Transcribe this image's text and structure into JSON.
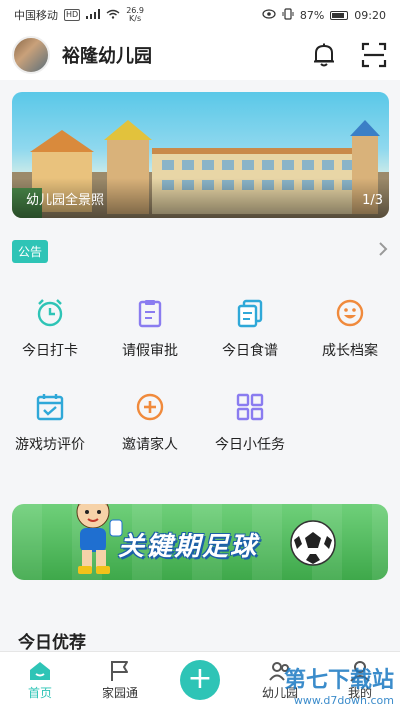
{
  "status_bar": {
    "carrier": "中国移动",
    "network_badge": "HD",
    "net_speed_value": "26.9",
    "net_speed_unit": "K/s",
    "battery": "87%",
    "time": "09:20"
  },
  "header": {
    "title": "裕隆幼儿园",
    "icons": [
      "bell-icon",
      "scan-icon"
    ]
  },
  "banner": {
    "caption": "幼儿园全景照",
    "counter": "1/3"
  },
  "notice": {
    "badge": "公告"
  },
  "features": [
    {
      "label": "今日打卡",
      "icon": "alarm-clock-icon",
      "color": "#2ec4b6"
    },
    {
      "label": "请假审批",
      "icon": "clipboard-icon",
      "color": "#8a7cf0"
    },
    {
      "label": "今日食谱",
      "icon": "documents-icon",
      "color": "#2fa8d8"
    },
    {
      "label": "成长档案",
      "icon": "smile-icon",
      "color": "#f08a3c"
    },
    {
      "label": "游戏坊评价",
      "icon": "calendar-check-icon",
      "color": "#2fa8d8"
    },
    {
      "label": "邀请家人",
      "icon": "plus-circle-icon",
      "color": "#f08a3c"
    },
    {
      "label": "今日小任务",
      "icon": "grid-icon",
      "color": "#8a7cf0"
    }
  ],
  "promo": {
    "title": "关键期足球"
  },
  "recommend": {
    "title": "今日优荐"
  },
  "tabbar": {
    "items": [
      {
        "label": "首页",
        "icon": "home-icon"
      },
      {
        "label": "家园通",
        "icon": "flag-icon"
      },
      {
        "label": "幼儿园",
        "icon": "people-icon"
      },
      {
        "label": "我的",
        "icon": "user-icon"
      }
    ],
    "active_color": "#2ec4b6"
  },
  "watermark": {
    "main": "第七下载站",
    "sub": "www.d7down.com"
  }
}
